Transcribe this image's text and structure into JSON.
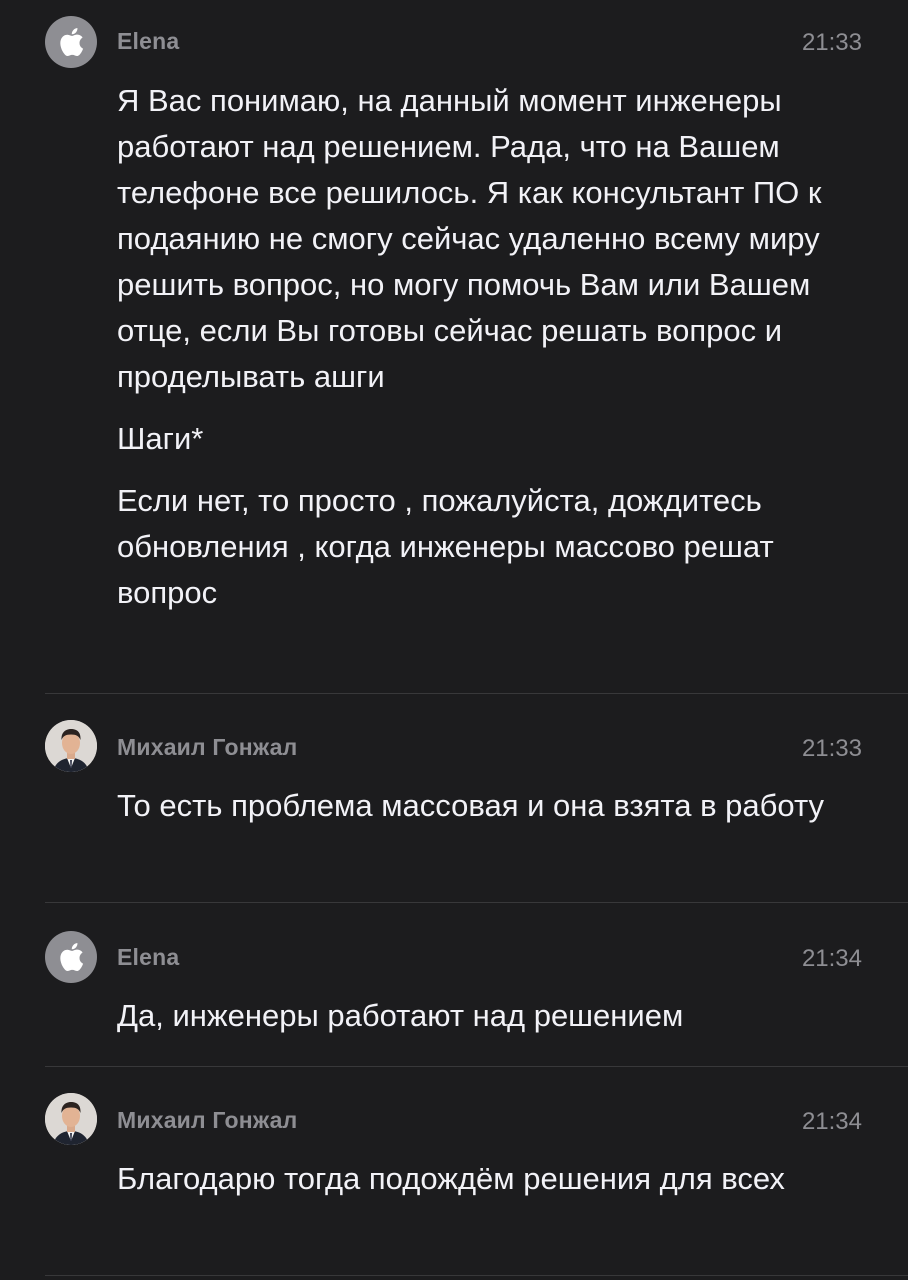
{
  "messages": [
    {
      "sender": "Elena",
      "avatar": "apple-logo-icon",
      "time": "21:33",
      "paragraphs": [
        "Я Вас понимаю, на данный момент инженеры работают над решением. Рада, что на Вашем телефоне все решилось. Я как консультант ПО к подаянию не смогу сейчас удаленно всему миру решить вопрос, но могу помочь Вам или Вашем отце, если Вы готовы сейчас решать вопрос и проделывать ашги",
        "Шаги*",
        "Если нет, то просто , пожалуйста, дождитесь обновления , когда инженеры массово решат вопрос"
      ]
    },
    {
      "sender": "Михаил Гонжал",
      "avatar": "user-photo-avatar",
      "time": "21:33",
      "paragraphs": [
        "То есть проблема массовая и она взята в работу"
      ]
    },
    {
      "sender": "Elena",
      "avatar": "apple-logo-icon",
      "time": "21:34",
      "paragraphs": [
        "Да, инженеры работают над решением"
      ]
    },
    {
      "sender": "Михаил Гонжал",
      "avatar": "user-photo-avatar",
      "time": "21:34",
      "paragraphs": [
        "Благодарю тогда подождём решения для всех"
      ]
    }
  ]
}
